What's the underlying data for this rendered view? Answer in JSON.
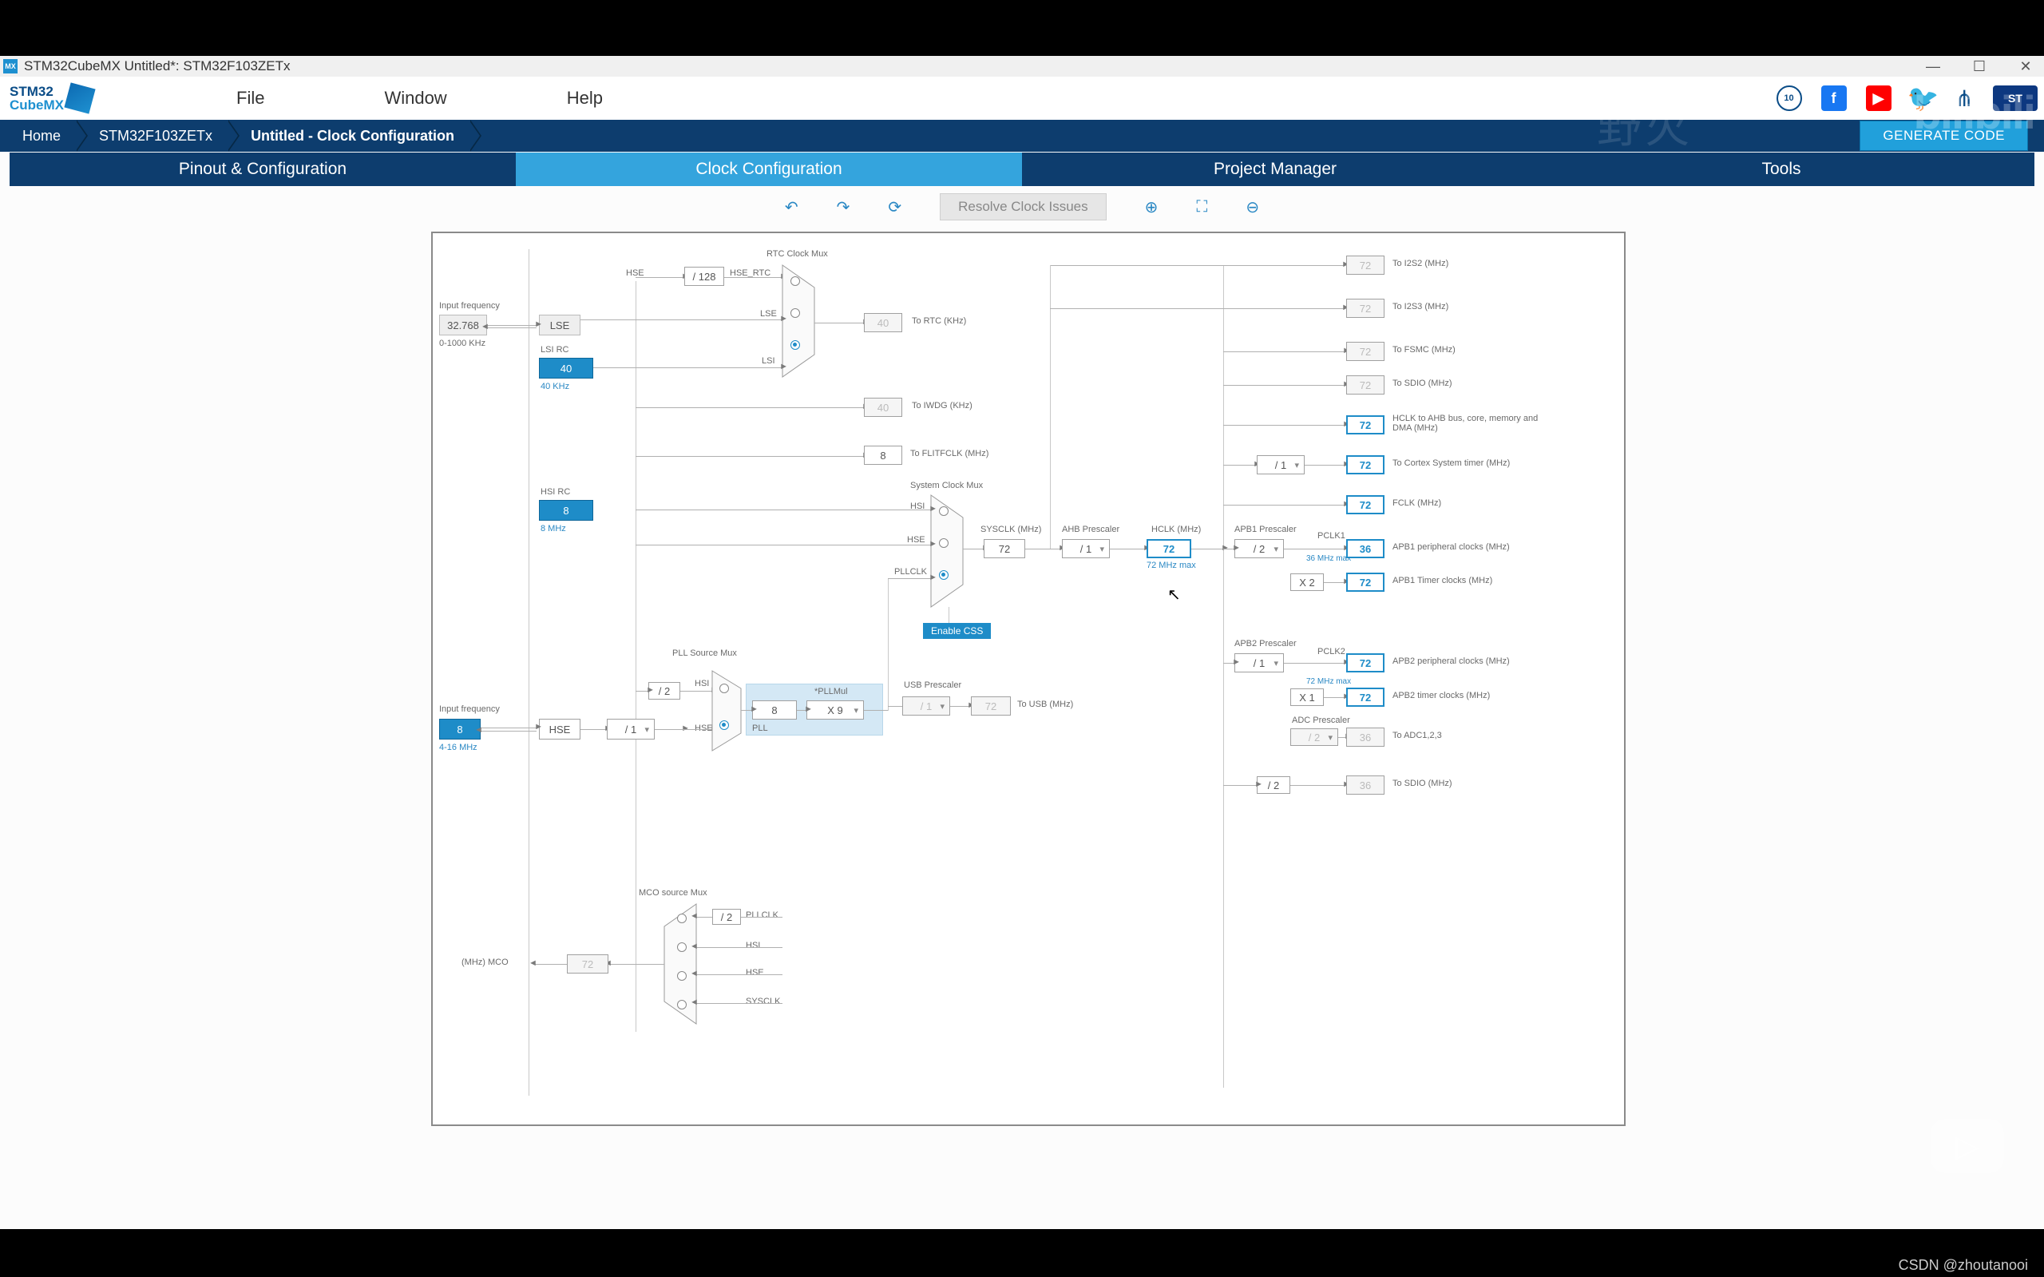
{
  "window": {
    "title": "STM32CubeMX Untitled*: STM32F103ZETx",
    "min": "—",
    "max": "☐",
    "close": "✕"
  },
  "logo": {
    "line1": "STM32",
    "line2": "CubeMX"
  },
  "menubar": {
    "file": "File",
    "window": "Window",
    "help": "Help"
  },
  "social": {
    "badge": "10",
    "fb": "f",
    "yt": "▶",
    "tw": "🐦",
    "net": "⋔",
    "st": "ST"
  },
  "breadcrumbs": {
    "home": "Home",
    "chip": "STM32F103ZETx",
    "page": "Untitled - Clock Configuration"
  },
  "generate": "GENERATE CODE",
  "tabs": {
    "pinout": "Pinout & Configuration",
    "clock": "Clock Configuration",
    "project": "Project Manager",
    "tools": "Tools"
  },
  "toolbar": {
    "undo": "↶",
    "redo": "↷",
    "refresh": "⟳",
    "resolve": "Resolve Clock Issues",
    "zoomin": "⊕",
    "fit": "⛶",
    "zoomout": "⊖"
  },
  "clock": {
    "lse": {
      "label": "LSE",
      "freq": "32.768",
      "range": "0-1000 KHz",
      "in_label": "Input frequency"
    },
    "lsi": {
      "label_top": "LSI RC",
      "freq": "40",
      "note": "40 KHz"
    },
    "hsi": {
      "label_top": "HSI RC",
      "freq": "8",
      "note": "8 MHz"
    },
    "hse": {
      "label": "HSE",
      "freq": "8",
      "range": "4-16 MHz",
      "in_label": "Input frequency",
      "prediv": "/ 1"
    },
    "hse_div128": "/ 128",
    "rtc_mux": {
      "title": "RTC Clock Mux",
      "hse_rtc": "HSE_RTC",
      "hse": "HSE",
      "lse": "LSE",
      "lsi": "LSI"
    },
    "to_rtc": "To RTC (KHz)",
    "rtc_val": "40",
    "to_iwdg": "To IWDG (KHz)",
    "iwdg_val": "40",
    "flitf": {
      "val": "8",
      "label": "To FLITFCLK (MHz)"
    },
    "sys_mux": {
      "title": "System Clock Mux",
      "hsi": "HSI",
      "hse": "HSE",
      "pllclk": "PLLCLK"
    },
    "enable_css": "Enable CSS",
    "pll_mux": {
      "title": "PLL Source Mux",
      "div2": "/ 2",
      "hsi": "HSI",
      "hse": "HSE"
    },
    "pll": {
      "in": "8",
      "mul": "X 9",
      "mul_label": "*PLLMul",
      "label": "PLL"
    },
    "usb": {
      "title": "USB Prescaler",
      "div": "/ 1",
      "val": "72",
      "label": "To USB (MHz)"
    },
    "sysclk": {
      "label": "SYSCLK (MHz)",
      "val": "72"
    },
    "ahb": {
      "label": "AHB Prescaler",
      "div": "/ 1"
    },
    "hclk": {
      "label": "HCLK (MHz)",
      "val": "72",
      "max": "72 MHz max"
    },
    "cortex_div": "/ 1",
    "out": {
      "i2s2": {
        "val": "72",
        "label": "To I2S2 (MHz)"
      },
      "i2s3": {
        "val": "72",
        "label": "To I2S3 (MHz)"
      },
      "fsmc": {
        "val": "72",
        "label": "To FSMC (MHz)"
      },
      "sdio": {
        "val": "72",
        "label": "To SDIO (MHz)"
      },
      "hclk_ahb": {
        "val": "72",
        "label": "HCLK to AHB bus, core, memory and DMA (MHz)"
      },
      "cortex": {
        "val": "72",
        "label": "To Cortex System timer (MHz)"
      },
      "fclk": {
        "val": "72",
        "label": "FCLK (MHz)"
      }
    },
    "apb1": {
      "label": "APB1 Prescaler",
      "div": "/ 2",
      "pclk1": "PCLK1",
      "pclk_note": "36 MHz max",
      "periph": {
        "val": "36",
        "label": "APB1 peripheral clocks (MHz)"
      },
      "mul": "X 2",
      "timer": {
        "val": "72",
        "label": "APB1 Timer clocks (MHz)"
      }
    },
    "apb2": {
      "label": "APB2 Prescaler",
      "div": "/ 1",
      "pclk2": "PCLK2",
      "pclk_note": "72 MHz max",
      "periph": {
        "val": "72",
        "label": "APB2 peripheral clocks (MHz)"
      },
      "mul": "X 1",
      "timer": {
        "val": "72",
        "label": "APB2 timer clocks (MHz)"
      },
      "adc": {
        "label": "ADC Prescaler",
        "div": "/ 2",
        "val": "36",
        "out": "To ADC1,2,3"
      },
      "sdio2": {
        "div": "/ 2",
        "val": "36",
        "out": "To SDIO (MHz)"
      }
    },
    "mco": {
      "title": "MCO source Mux",
      "pllclk": "PLLCLK",
      "div2": "/ 2",
      "hsi": "HSI",
      "hse": "HSE",
      "sysclk": "SYSCLK",
      "val": "72",
      "label": "(MHz) MCO"
    }
  },
  "watermark": {
    "left": "野火",
    "right": "bilibili",
    "csdn": "CSDN @zhoutanooi"
  }
}
